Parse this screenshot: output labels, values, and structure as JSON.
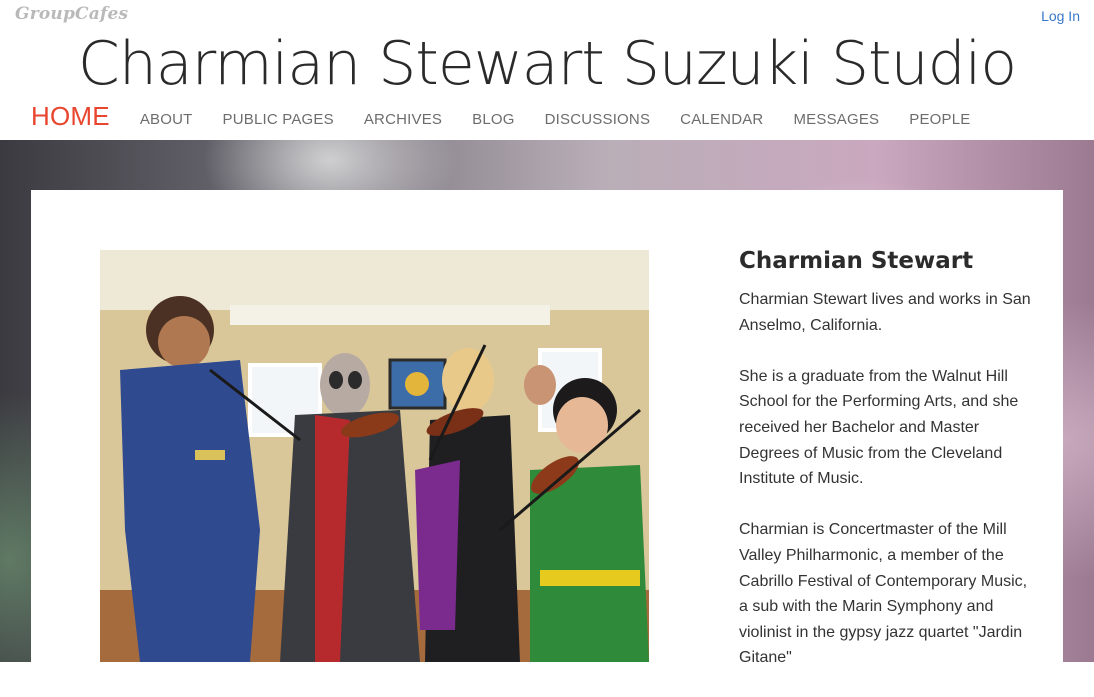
{
  "brand": {
    "name": "GroupCafes"
  },
  "auth": {
    "login_label": "Log In"
  },
  "site": {
    "title": "Charmian Stewart Suzuki Studio"
  },
  "nav": {
    "items": [
      {
        "label": "HOME",
        "active": true
      },
      {
        "label": "ABOUT"
      },
      {
        "label": "PUBLIC PAGES"
      },
      {
        "label": "ARCHIVES"
      },
      {
        "label": "BLOG"
      },
      {
        "label": "DISCUSSIONS"
      },
      {
        "label": "CALENDAR"
      },
      {
        "label": "MESSAGES"
      },
      {
        "label": "PEOPLE"
      }
    ]
  },
  "main": {
    "bio_title": "Charmian Stewart",
    "paragraphs": [
      "Charmian Stewart lives and works in San Anselmo, California.",
      "She is a graduate from the Walnut Hill School for the Performing Arts, and she received her Bachelor and Master Degrees of Music from the Cleveland Institute of Music.",
      "Charmian is Concertmaster of the Mill Valley Philharmonic, a member of the Cabrillo Festival of Contemporary Music, a sub with the Marin Symphony and violinist in the gypsy jazz quartet \"Jardin Gitane\""
    ]
  },
  "colors": {
    "accent": "#e8462f",
    "link": "#3a78c9",
    "nav_text": "#6d6d6d"
  }
}
